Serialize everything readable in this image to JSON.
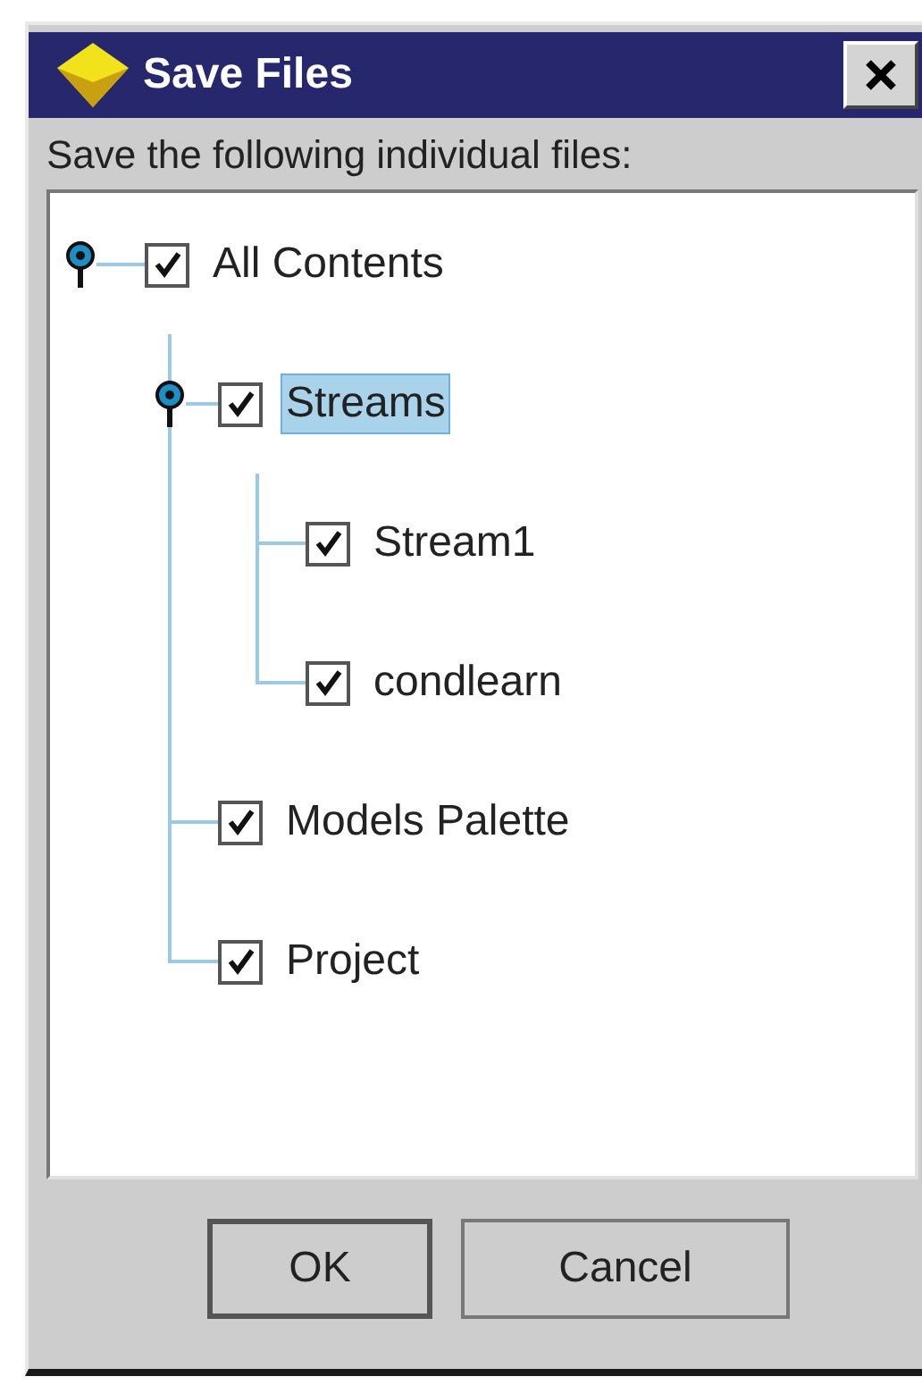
{
  "window": {
    "title": "Save Files"
  },
  "prompt": "Save the following individual files:",
  "tree": [
    {
      "label": "All Contents",
      "checked": true,
      "selected": false,
      "expanded": true,
      "children": [
        {
          "label": "Streams",
          "checked": true,
          "selected": true,
          "expanded": true,
          "children": [
            {
              "label": "Stream1",
              "checked": true,
              "selected": false
            },
            {
              "label": "condlearn",
              "checked": true,
              "selected": false
            }
          ]
        },
        {
          "label": "Models Palette",
          "checked": true,
          "selected": false
        },
        {
          "label": "Project",
          "checked": true,
          "selected": false
        }
      ]
    }
  ],
  "buttons": [
    {
      "label": "OK",
      "default": true
    },
    {
      "label": "Cancel",
      "default": false
    }
  ]
}
